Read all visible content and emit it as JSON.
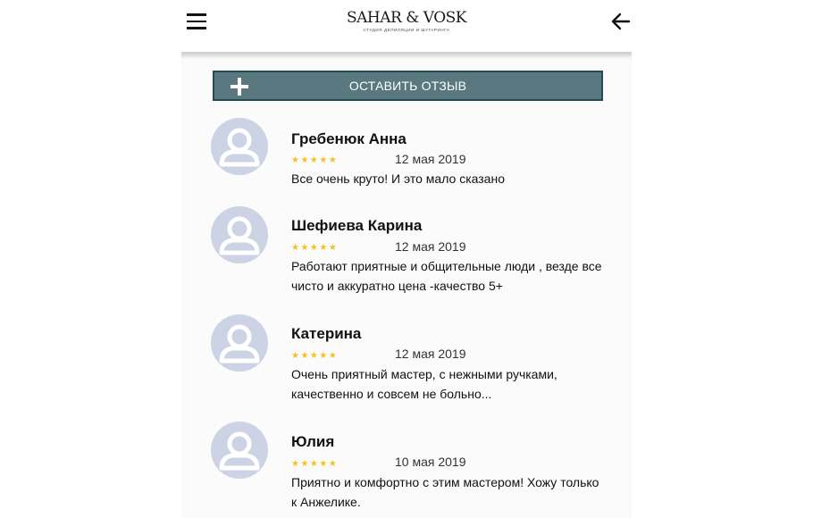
{
  "header": {
    "brand_name": "SAHAR & VOSK",
    "brand_tagline": "студия депиляции и шугаринга",
    "menu_icon": "hamburger-menu-icon",
    "back_icon": "arrow-left-icon"
  },
  "actions": {
    "add_review_label": "ОСТАВИТЬ ОТЗЫВ",
    "add_review_icon": "plus-icon"
  },
  "reviews": [
    {
      "name": "Гребенюк Анна",
      "rating": 5,
      "stars": "★★★★★",
      "date": "12 мая 2019",
      "text": "Все очень круто! И это мало сказано"
    },
    {
      "name": "Шефиева Карина",
      "rating": 5,
      "stars": "★★★★★",
      "date": "12 мая 2019",
      "text": "Работают приятные и общительные люди , везде все чисто и аккуратно цена -качество 5+"
    },
    {
      "name": "Катерина",
      "rating": 5,
      "stars": "★★★★★",
      "date": "12 мая 2019",
      "text": "Очень приятный мастер, с нежными ручками, качественно и совсем не больно..."
    },
    {
      "name": "Юлия",
      "rating": 5,
      "stars": "★★★★★",
      "date": "10 мая 2019",
      "text": "Приятно и комфортно с этим мастером! Хожу только к Анжелике."
    }
  ],
  "colors": {
    "button_bg": "#5a7880",
    "button_border": "#244c55",
    "star": "#f0c41b",
    "avatar_bg": "#ccd3e5"
  }
}
